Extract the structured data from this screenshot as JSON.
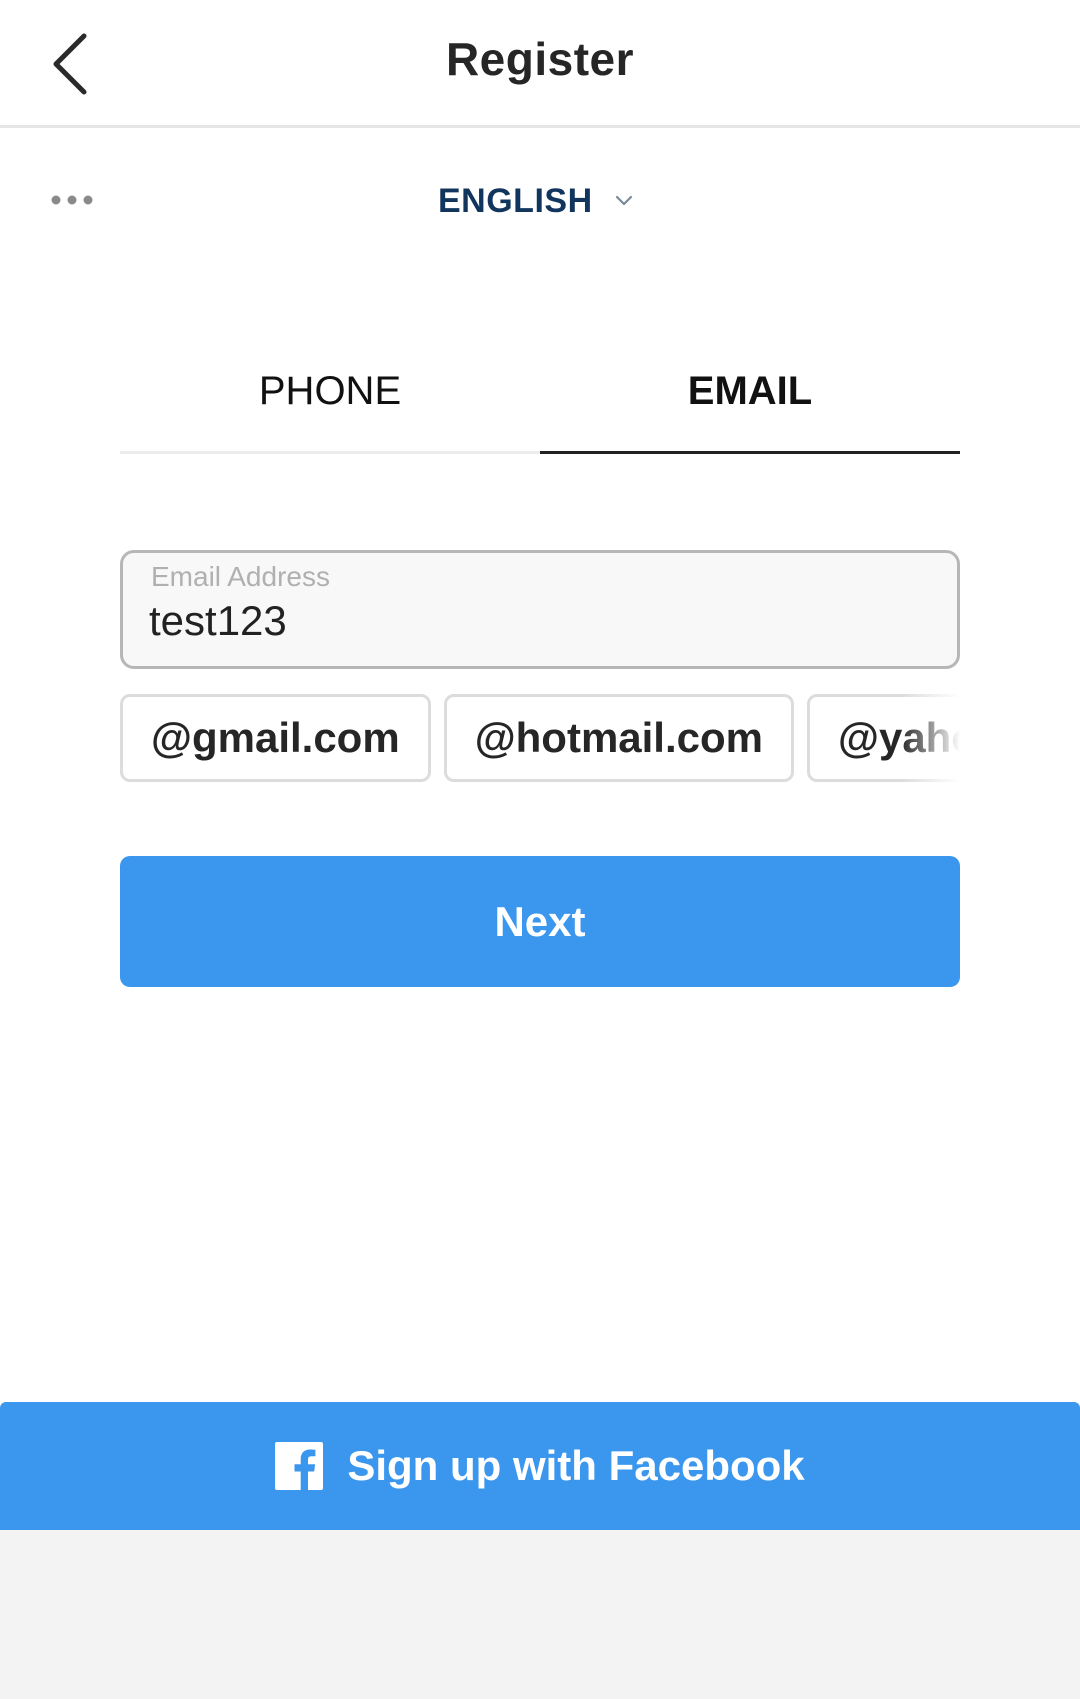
{
  "header": {
    "title": "Register",
    "back_icon": "chevron-left-icon"
  },
  "language": {
    "more_icon": "more-horizontal-icon",
    "selected": "ENGLISH",
    "dropdown_icon": "chevron-down-icon"
  },
  "tabs": [
    {
      "label": "PHONE",
      "active": false
    },
    {
      "label": "EMAIL",
      "active": true
    }
  ],
  "email_field": {
    "label": "Email Address",
    "value": "test123"
  },
  "domain_suggestions": [
    "@gmail.com",
    "@hotmail.com",
    "@yahoo"
  ],
  "next_button": {
    "label": "Next"
  },
  "facebook": {
    "label": "Sign up with Facebook",
    "icon": "facebook-icon"
  },
  "colors": {
    "primary": "#3b97ee",
    "language": "#12355e",
    "bottom_area": "#f3f3f3"
  }
}
